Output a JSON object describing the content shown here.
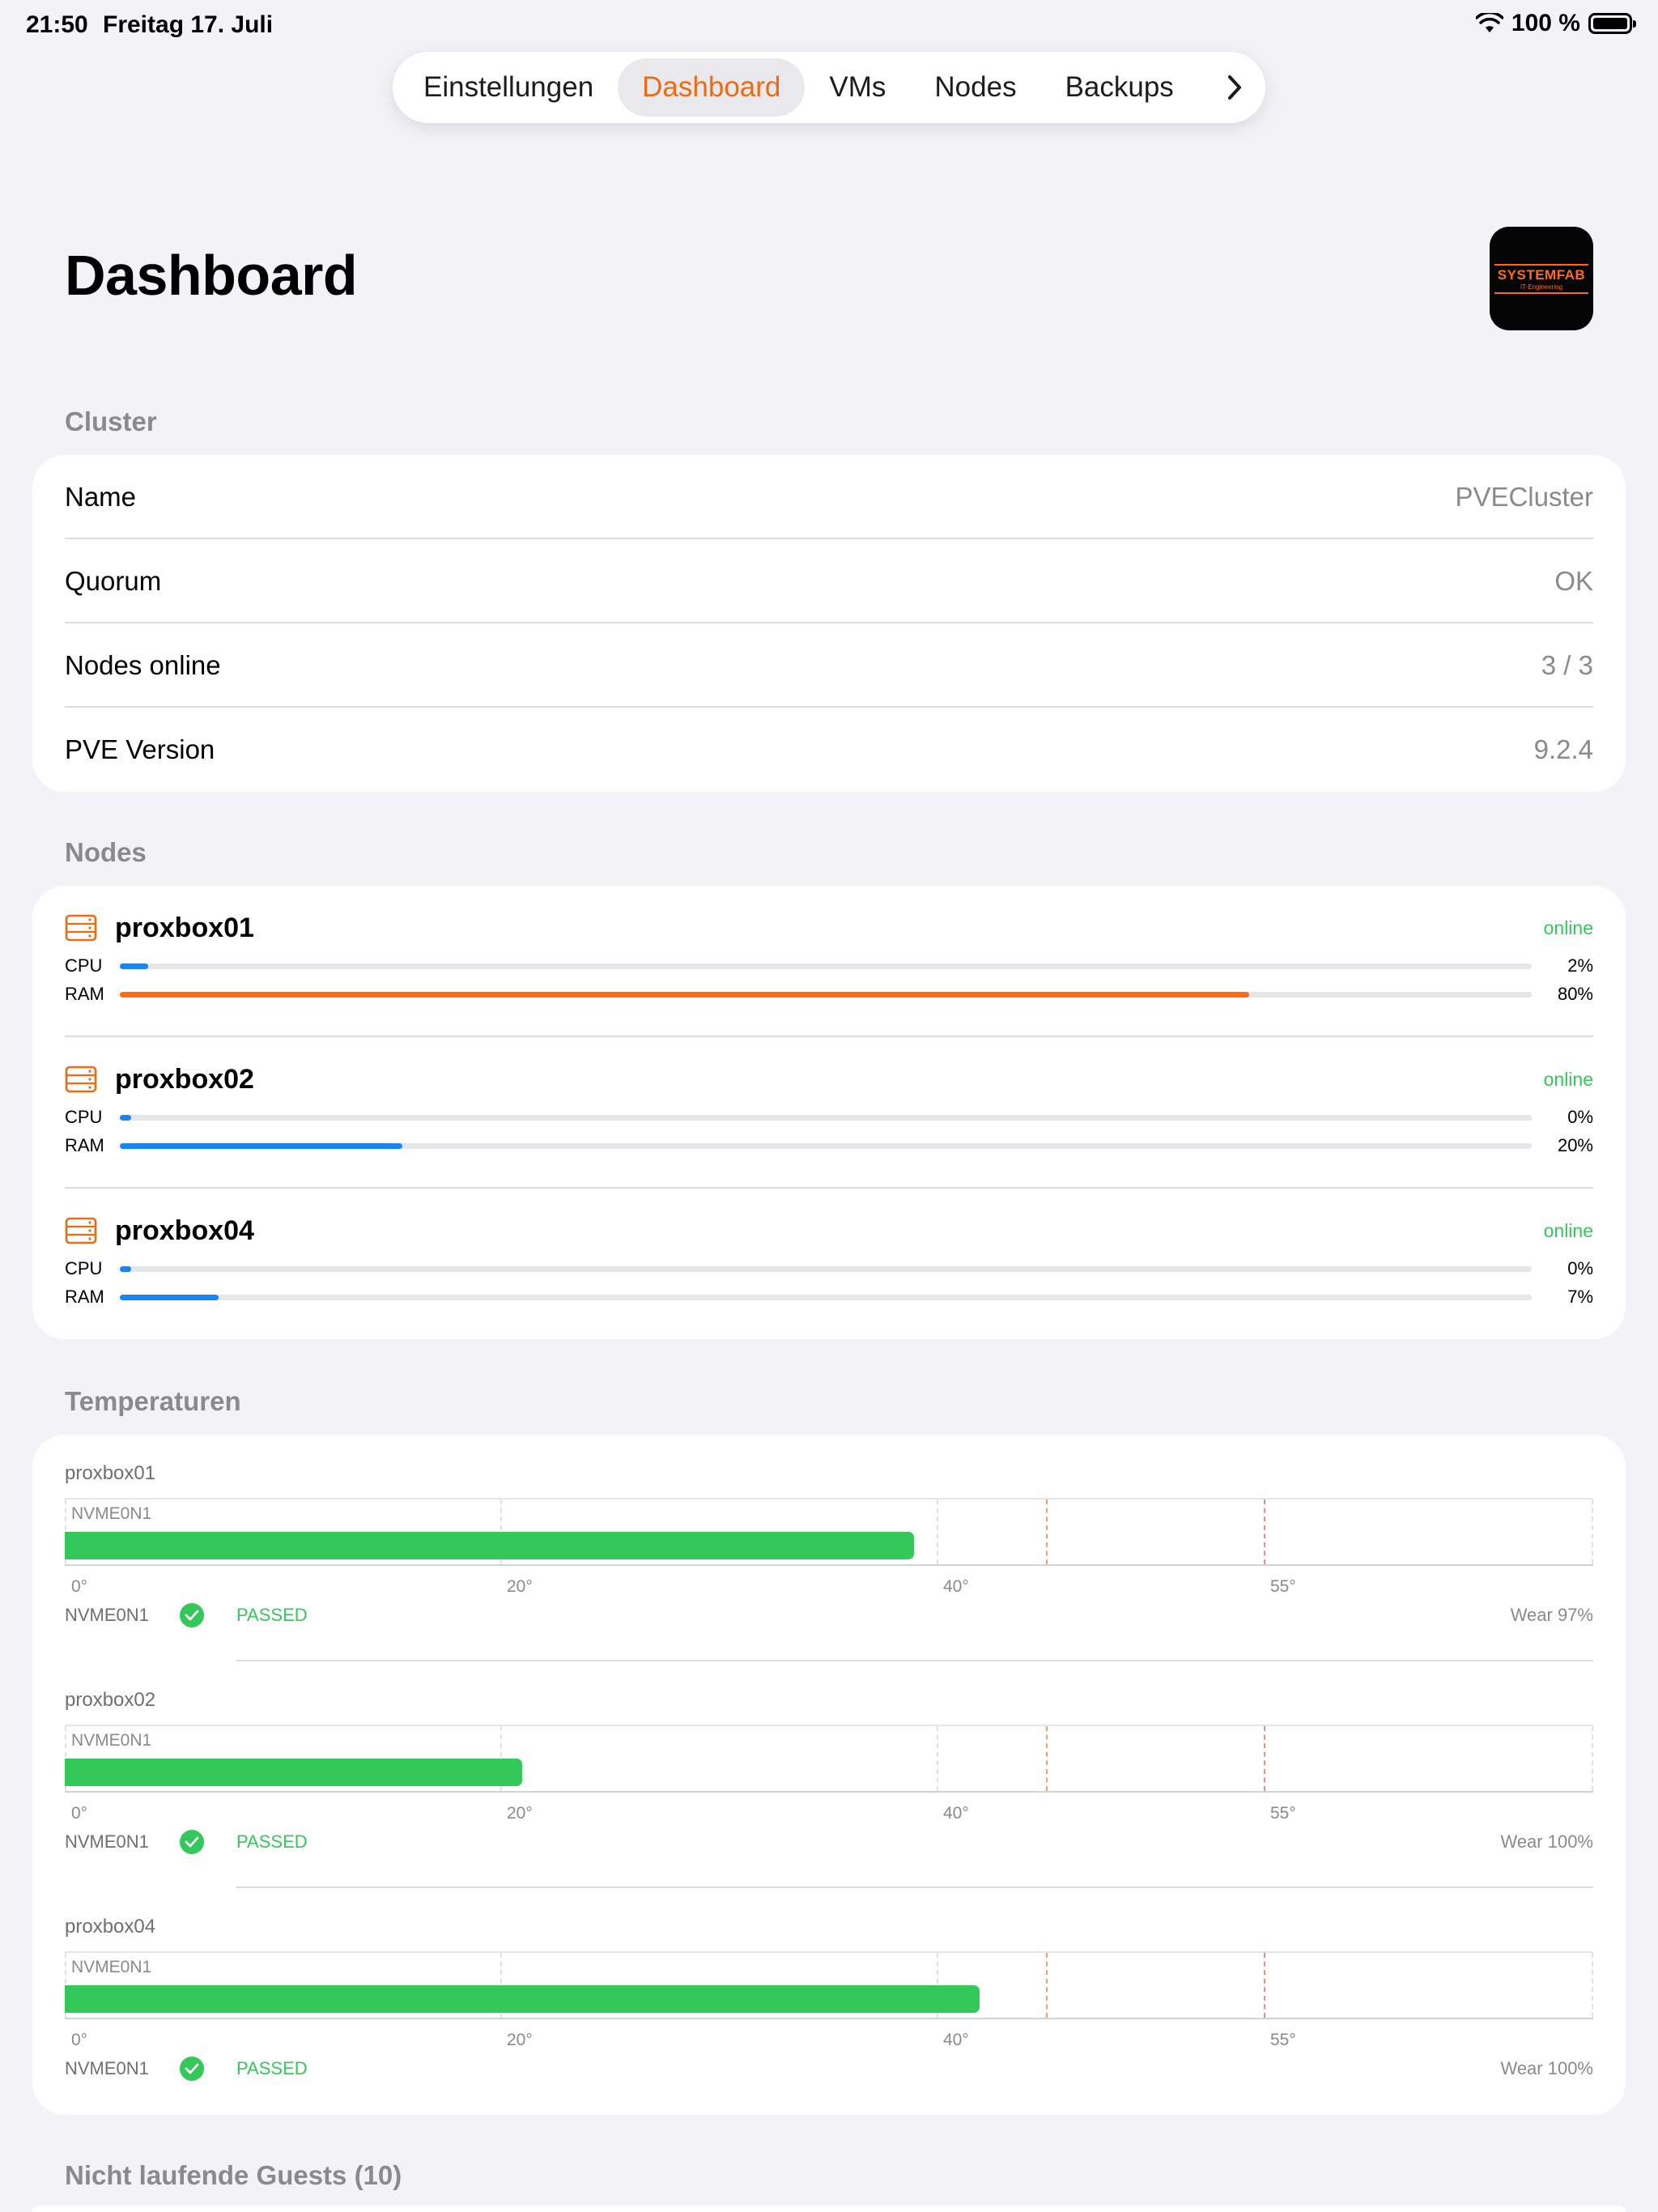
{
  "status_bar": {
    "time": "21:50",
    "date": "Freitag 17. Juli",
    "battery": "100 %"
  },
  "tabs": [
    {
      "label": "Einstellungen",
      "active": false
    },
    {
      "label": "Dashboard",
      "active": true
    },
    {
      "label": "VMs",
      "active": false
    },
    {
      "label": "Nodes",
      "active": false
    },
    {
      "label": "Backups",
      "active": false
    }
  ],
  "page_title": "Dashboard",
  "logo": {
    "main": "SYSTEMFAB",
    "sub": "IT-Engineering"
  },
  "cluster": {
    "section_title": "Cluster",
    "rows": [
      {
        "label": "Name",
        "value": "PVECluster"
      },
      {
        "label": "Quorum",
        "value": "OK"
      },
      {
        "label": "Nodes online",
        "value": "3 / 3"
      },
      {
        "label": "PVE Version",
        "value": "9.2.4"
      }
    ]
  },
  "nodes": {
    "section_title": "Nodes",
    "items": [
      {
        "name": "proxbox01",
        "status": "online",
        "cpu_label": "CPU",
        "cpu": "2%",
        "cpu_value": 2,
        "ram_label": "RAM",
        "ram": "80%",
        "ram_value": 80
      },
      {
        "name": "proxbox02",
        "status": "online",
        "cpu_label": "CPU",
        "cpu": "0%",
        "cpu_value": 0,
        "ram_label": "RAM",
        "ram": "20%",
        "ram_value": 20
      },
      {
        "name": "proxbox04",
        "status": "online",
        "cpu_label": "CPU",
        "cpu": "0%",
        "cpu_value": 0,
        "ram_label": "RAM",
        "ram": "7%",
        "ram_value": 7
      }
    ]
  },
  "temperatures": {
    "section_title": "Temperaturen",
    "axis_ticks": [
      "0°",
      "20°",
      "40°",
      "55°"
    ],
    "blocks": [
      {
        "node": "proxbox01",
        "disk": "NVME0N1",
        "temp_value": 39,
        "smart": "PASSED",
        "wear": "Wear 97%"
      },
      {
        "node": "proxbox02",
        "disk": "NVME0N1",
        "temp_value": 21,
        "smart": "PASSED",
        "wear": "Wear 100%"
      },
      {
        "node": "proxbox04",
        "disk": "NVME0N1",
        "temp_value": 42,
        "smart": "PASSED",
        "wear": "Wear 100%"
      }
    ]
  },
  "stopped_guests": {
    "section_title": "Nicht laufende Guests (10)"
  },
  "colors": {
    "accent": "#f26a0f",
    "online": "#34c759",
    "cpu_bar": "#1a84f0",
    "ram_high": "#ff6a14",
    "ram_normal": "#1a84f0",
    "temp_bar": "#34c759"
  }
}
